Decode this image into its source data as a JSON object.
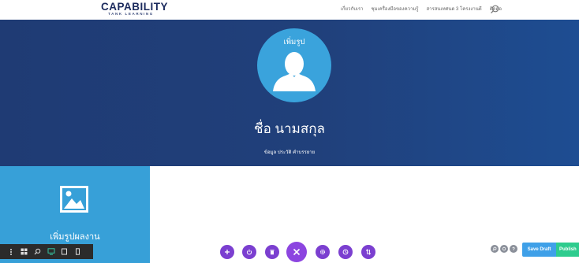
{
  "header": {
    "logo_main": "CAPABILITY",
    "logo_sub": "TANK LEARNING",
    "nav": [
      "เกี่ยวกับเรา",
      "ชุมเครื่องมือของความรู้",
      "สารสนเทศนด 3 โครงงานดี",
      "ติดต่อ"
    ]
  },
  "hero": {
    "avatar_label": "เพิ่มรูป",
    "name": "ชื่อ นามสกุล",
    "description": "ข้อมูล ประวัติ คำบรรยาย"
  },
  "work": {
    "label": "เพิ่มรูปผลงาน"
  },
  "actions": {
    "save_draft": "Save Draft",
    "publish": "Publish"
  },
  "colors": {
    "hero_bg": "#20407b",
    "accent_blue": "#37a0d8",
    "purple": "#7b3fd0",
    "publish_green": "#2ecc8e"
  }
}
